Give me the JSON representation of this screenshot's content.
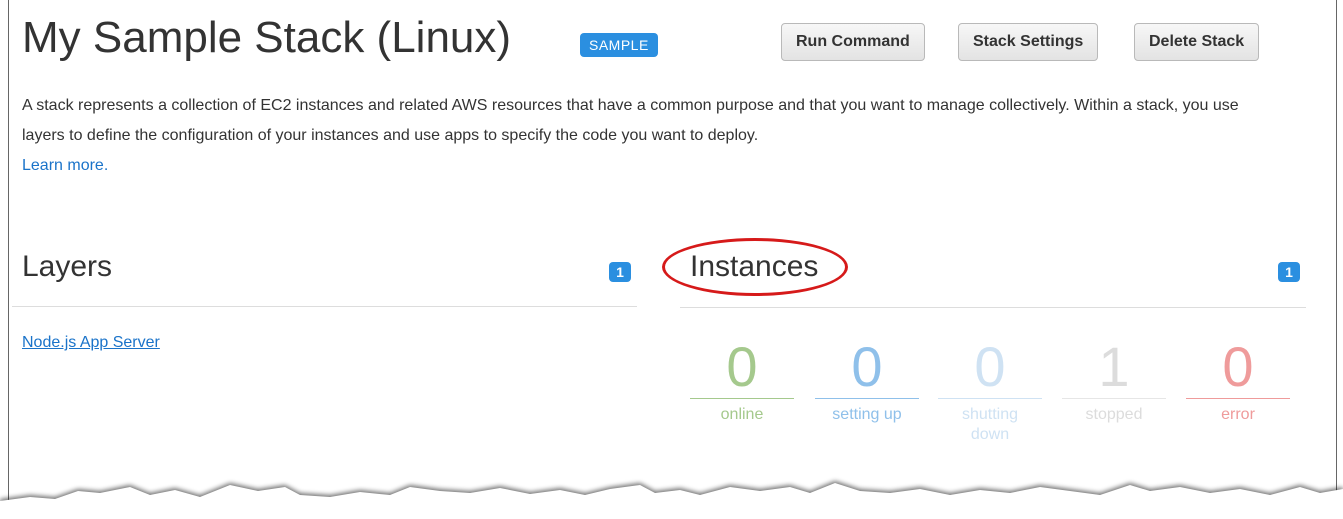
{
  "header": {
    "title": "My Sample Stack (Linux)",
    "badge": "SAMPLE",
    "buttons": {
      "run_command": "Run Command",
      "stack_settings": "Stack Settings",
      "delete_stack": "Delete Stack"
    }
  },
  "description": {
    "text": "A stack represents a collection of EC2 instances and related AWS resources that have a common purpose and that you want to manage collectively. Within a stack, you use layers to define the configuration of your instances and use apps to specify the code you want to deploy.",
    "learn_more": "Learn more."
  },
  "layers": {
    "title": "Layers",
    "count": "1",
    "items": [
      "Node.js App Server"
    ]
  },
  "instances": {
    "title": "Instances",
    "count": "1",
    "stats": [
      {
        "value": "0",
        "label": "online",
        "color": "#a5c98d"
      },
      {
        "value": "0",
        "label": "setting up",
        "color": "#8fc0ea"
      },
      {
        "value": "0",
        "label": "shutting down",
        "color": "#cfe2f3"
      },
      {
        "value": "1",
        "label": "stopped",
        "color": "#dcdcdc"
      },
      {
        "value": "0",
        "label": "error",
        "color": "#ef9b9b"
      }
    ]
  },
  "colors": {
    "accent": "#1a73c9",
    "badge": "#2b8fe0",
    "annotation": "#d61a1a"
  }
}
